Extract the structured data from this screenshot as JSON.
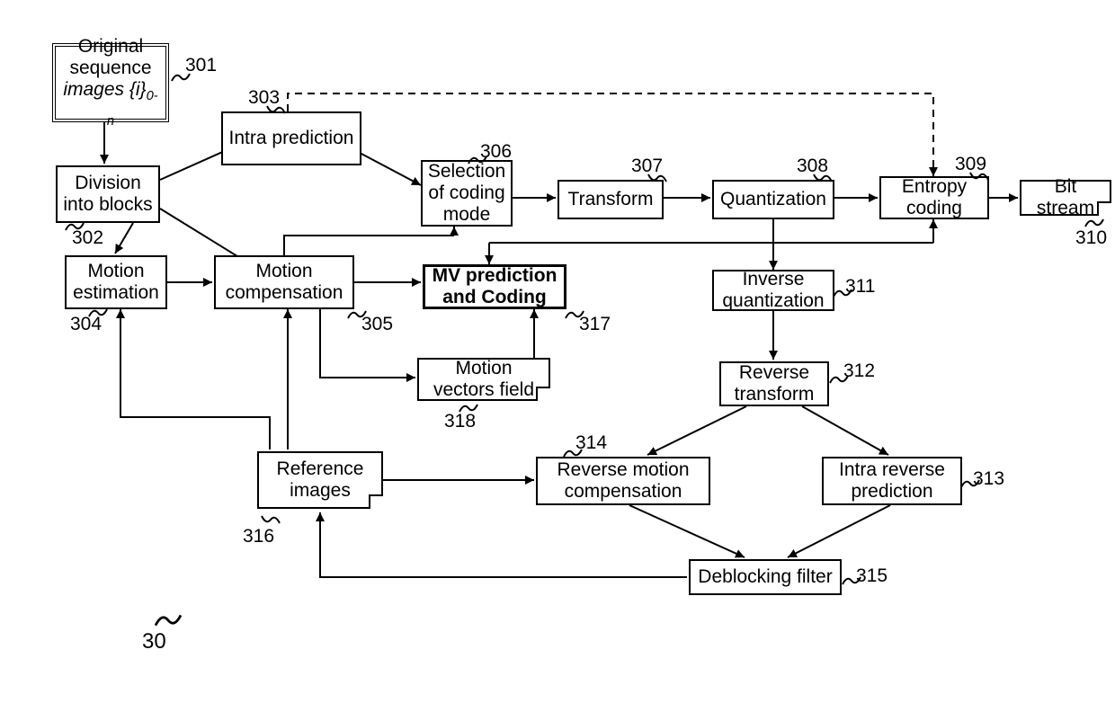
{
  "nodes": {
    "original": {
      "line1": "Original",
      "line2": "sequence",
      "line3_prefix": "images {i}",
      "line3_sub": "0-n"
    },
    "division": "Division into blocks",
    "intra_pred": "Intra prediction",
    "motion_est": "Motion estimation",
    "motion_comp": "Motion compensation",
    "selection": "Selection of coding mode",
    "transform": "Transform",
    "quant": "Quantization",
    "entropy": "Entropy coding",
    "bitstream": "Bit stream",
    "mv_pred": "MV prediction and Coding",
    "mv_field": "Motion vectors field",
    "inv_quant": "Inverse quantization",
    "rev_trans": "Reverse transform",
    "rev_mc": "Reverse motion compensation",
    "intra_rev": "Intra reverse prediction",
    "deblock": "Deblocking filter",
    "ref_img": "Reference images"
  },
  "refs": {
    "r301": "301",
    "r302": "302",
    "r303": "303",
    "r304": "304",
    "r305": "305",
    "r306": "306",
    "r307": "307",
    "r308": "308",
    "r309": "309",
    "r310": "310",
    "r311": "311",
    "r312": "312",
    "r313": "313",
    "r314": "314",
    "r315": "315",
    "r316": "316",
    "r317": "317",
    "r318": "318",
    "r30": "30"
  }
}
